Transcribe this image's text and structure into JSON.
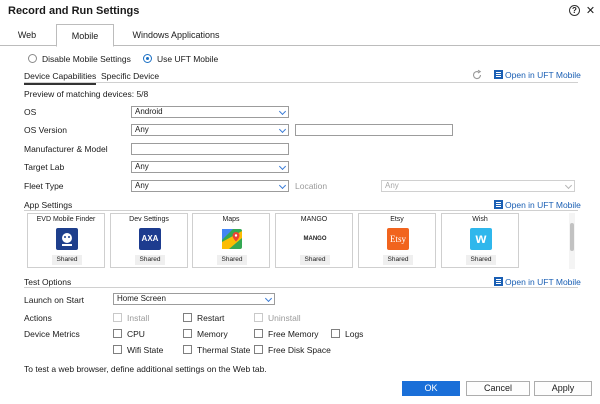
{
  "window": {
    "title": "Record and Run Settings",
    "help_glyph": "?",
    "close_glyph": "✕"
  },
  "tabs": [
    {
      "label": "Web"
    },
    {
      "label": "Mobile"
    },
    {
      "label": "Windows Applications"
    }
  ],
  "mode": {
    "disable_label": "Disable Mobile Settings",
    "use_label": "Use UFT Mobile",
    "selected": "Use UFT Mobile"
  },
  "device_section": {
    "tab_capabilities": "Device Capabilities",
    "tab_specific": "Specific Device",
    "open_link": "Open in UFT Mobile",
    "preview_text": "Preview of matching devices: 5/8",
    "os_label": "OS",
    "os_value": "Android",
    "os_version_label": "OS Version",
    "os_version_value": "Any",
    "manufacturer_label": "Manufacturer & Model",
    "target_lab_label": "Target Lab",
    "target_lab_value": "Any",
    "fleet_type_label": "Fleet Type",
    "fleet_type_value": "Any",
    "location_label": "Location",
    "location_value": "Any"
  },
  "app_settings": {
    "title": "App Settings",
    "open_link": "Open in UFT Mobile",
    "apps": [
      {
        "name": "EVD Mobile Finder",
        "badge": "Shared",
        "icon": "evd-app-icon",
        "color": "#1e3f8c"
      },
      {
        "name": "Dev Settings",
        "badge": "Shared",
        "icon": "axa-app-icon",
        "color": "#1d3c8f",
        "text": "AXA"
      },
      {
        "name": "Maps",
        "badge": "Shared",
        "icon": "maps-app-icon",
        "color": "#34a853"
      },
      {
        "name": "MANGO",
        "badge": "Shared",
        "icon": "mango-app-icon",
        "color": "#ffffff",
        "text": "MANGO"
      },
      {
        "name": "Etsy",
        "badge": "Shared",
        "icon": "etsy-app-icon",
        "color": "#f1641e",
        "text": "Etsy"
      },
      {
        "name": "Wish",
        "badge": "Shared",
        "icon": "wish-app-icon",
        "color": "#2fb7ec",
        "text": "w"
      }
    ]
  },
  "test_options": {
    "title": "Test Options",
    "open_link": "Open in UFT Mobile",
    "launch_label": "Launch on Start",
    "launch_value": "Home Screen",
    "actions_label": "Actions",
    "install_label": "Install",
    "restart_label": "Restart",
    "uninstall_label": "Uninstall",
    "metrics_label": "Device Metrics",
    "cpu_label": "CPU",
    "memory_label": "Memory",
    "free_memory_label": "Free Memory",
    "logs_label": "Logs",
    "wifi_label": "Wifi State",
    "thermal_label": "Thermal State",
    "free_disk_label": "Free Disk Space"
  },
  "footer": {
    "hint": "To test a web browser, define additional settings on the Web tab.",
    "ok": "OK",
    "cancel": "Cancel",
    "apply": "Apply"
  }
}
